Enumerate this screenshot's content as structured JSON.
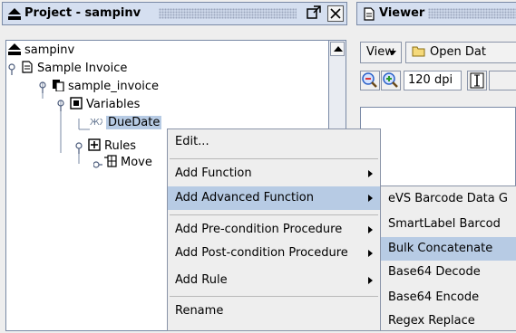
{
  "project_panel": {
    "title": "Project - sampinv",
    "tree": [
      {
        "label": "sampinv"
      },
      {
        "label": "Sample Invoice"
      },
      {
        "label": "sample_invoice"
      },
      {
        "label": "Variables"
      },
      {
        "label": "DueDate"
      },
      {
        "label": "Rules"
      },
      {
        "label": "Move"
      }
    ]
  },
  "viewer_panel": {
    "title": "Viewer",
    "view_menu": "View",
    "open_button": "Open Dat",
    "dpi": "120 dpi"
  },
  "context_menu": {
    "items": [
      {
        "label": "Edit...",
        "submenu": false
      },
      {
        "label": "Add Function",
        "submenu": true
      },
      {
        "label": "Add Advanced Function",
        "submenu": true,
        "highlighted": true
      },
      {
        "label": "Add Pre-condition Procedure",
        "submenu": true
      },
      {
        "label": "Add Post-condition Procedure",
        "submenu": true
      },
      {
        "label": "Add Rule",
        "submenu": true
      },
      {
        "label": "Rename",
        "submenu": false
      }
    ]
  },
  "submenu": {
    "items": [
      {
        "label": "eVS Barcode Data G"
      },
      {
        "label": "SmartLabel Barcod"
      },
      {
        "label": "Bulk Concatenate",
        "highlighted": true
      },
      {
        "label": "Base64 Decode"
      },
      {
        "label": "Base64 Encode"
      },
      {
        "label": "Regex Replace"
      }
    ]
  },
  "colors": {
    "title_bg": "#d5dff0",
    "selection": "#b7cbe4",
    "menu_bg": "#eeeeee"
  }
}
